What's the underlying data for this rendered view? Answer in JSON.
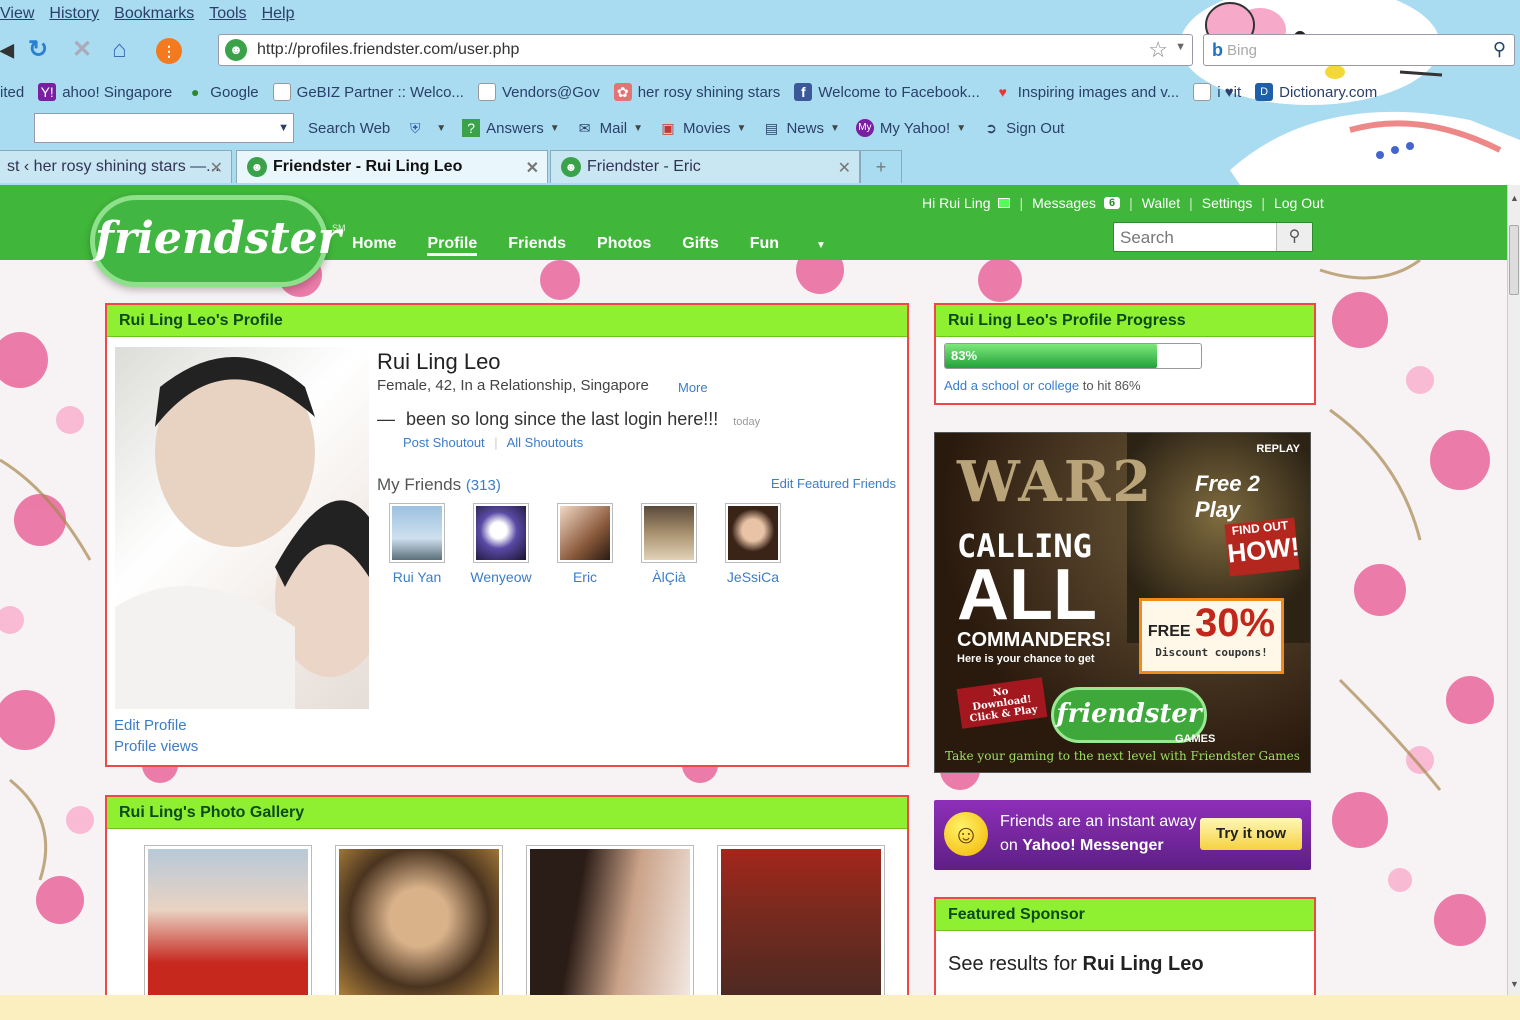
{
  "browser": {
    "menu": [
      "View",
      "History",
      "Bookmarks",
      "Tools",
      "Help"
    ],
    "url": "http://profiles.friendster.com/user.php",
    "search_placeholder": "Bing",
    "bookmarks": [
      {
        "label": "ited",
        "icon": "most-visited-icon"
      },
      {
        "label": "ahoo! Singapore",
        "icon": "yahoo-icon"
      },
      {
        "label": "Google",
        "icon": "google-icon"
      },
      {
        "label": "GeBIZ Partner :: Welco...",
        "icon": "page-icon"
      },
      {
        "label": "Vendors@Gov",
        "icon": "page-icon"
      },
      {
        "label": "her rosy shining stars",
        "icon": "blog-icon"
      },
      {
        "label": "Welcome to Facebook...",
        "icon": "facebook-icon"
      },
      {
        "label": "Inspiring images and v...",
        "icon": "heart-icon"
      },
      {
        "label": "i ♥it",
        "icon": "page-icon"
      },
      {
        "label": "Dictionary.com",
        "icon": "dictionary-icon"
      }
    ],
    "toolbar": [
      {
        "label": "Search Web",
        "icon": "search-web-icon"
      },
      {
        "label": "",
        "icon": "shield-icon"
      },
      {
        "label": "Answers",
        "icon": "answers-icon"
      },
      {
        "label": "Mail",
        "icon": "mail-icon"
      },
      {
        "label": "Movies",
        "icon": "movies-icon"
      },
      {
        "label": "News",
        "icon": "news-icon"
      },
      {
        "label": "My Yahoo!",
        "icon": "my-yahoo-icon"
      },
      {
        "label": "Sign Out",
        "icon": "sign-out-icon"
      }
    ],
    "tabs": [
      {
        "label": "st ‹ her rosy shining stars —..."
      },
      {
        "label": "Friendster - Rui Ling Leo"
      },
      {
        "label": "Friendster - Eric"
      }
    ]
  },
  "site": {
    "logo": "friendster",
    "nav": [
      "Home",
      "Profile",
      "Friends",
      "Photos",
      "Gifts",
      "Fun"
    ],
    "user_greeting": "Hi Rui Ling",
    "messages_label": "Messages",
    "messages_count": "6",
    "wallet": "Wallet",
    "settings": "Settings",
    "logout": "Log Out",
    "search_placeholder": "Search"
  },
  "profile": {
    "panel_title": "Rui Ling Leo's Profile",
    "name": "Rui Ling Leo",
    "details": "Female, 42, In a Relationship, Singapore",
    "more": "More",
    "shoutout_dash": "—",
    "shoutout": "been so long since the last login here!!!",
    "shoutout_time": "today",
    "post_shoutout": "Post Shoutout",
    "all_shoutouts": "All Shoutouts",
    "friends_label": "My Friends",
    "friends_count": "(313)",
    "edit_featured": "Edit Featured Friends",
    "edit_profile": "Edit Profile",
    "profile_views": "Profile views",
    "friends": [
      {
        "name": "Rui Yan"
      },
      {
        "name": "Wenyeow"
      },
      {
        "name": "Eric"
      },
      {
        "name": "ÀlÇià"
      },
      {
        "name": "JeSsiCa"
      }
    ]
  },
  "progress": {
    "title": "Rui Ling Leo's Profile Progress",
    "percent_label": "83%",
    "value": 0.83,
    "link": "Add a school or college",
    "suffix": "to hit 86%"
  },
  "ad": {
    "replay": "REPLAY",
    "line1": "WAR2",
    "free2play": "Free 2 Play",
    "calling": "CALLING",
    "all": "ALL",
    "commanders": "COMMANDERS!",
    "chance": "Here is your chance to get",
    "findout1": "FIND OUT",
    "findout2": "HOW!",
    "free": "FREE",
    "pct": "30%",
    "coupons": "Discount coupons!",
    "nodownload": "No Download!",
    "clickplay": "Click & Play",
    "logo": "friendster",
    "games": "GAMES",
    "tagline": "Take your gaming to the next level with Friendster Games"
  },
  "messenger": {
    "line1": "Friends are an instant away",
    "line2a": "on ",
    "line2b": "Yahoo! Messenger",
    "button": "Try it now"
  },
  "gallery": {
    "title": "Rui Ling's Photo Gallery"
  },
  "sponsor": {
    "title": "Featured Sponsor",
    "text": "See results for ",
    "name": "Rui Ling Leo"
  }
}
